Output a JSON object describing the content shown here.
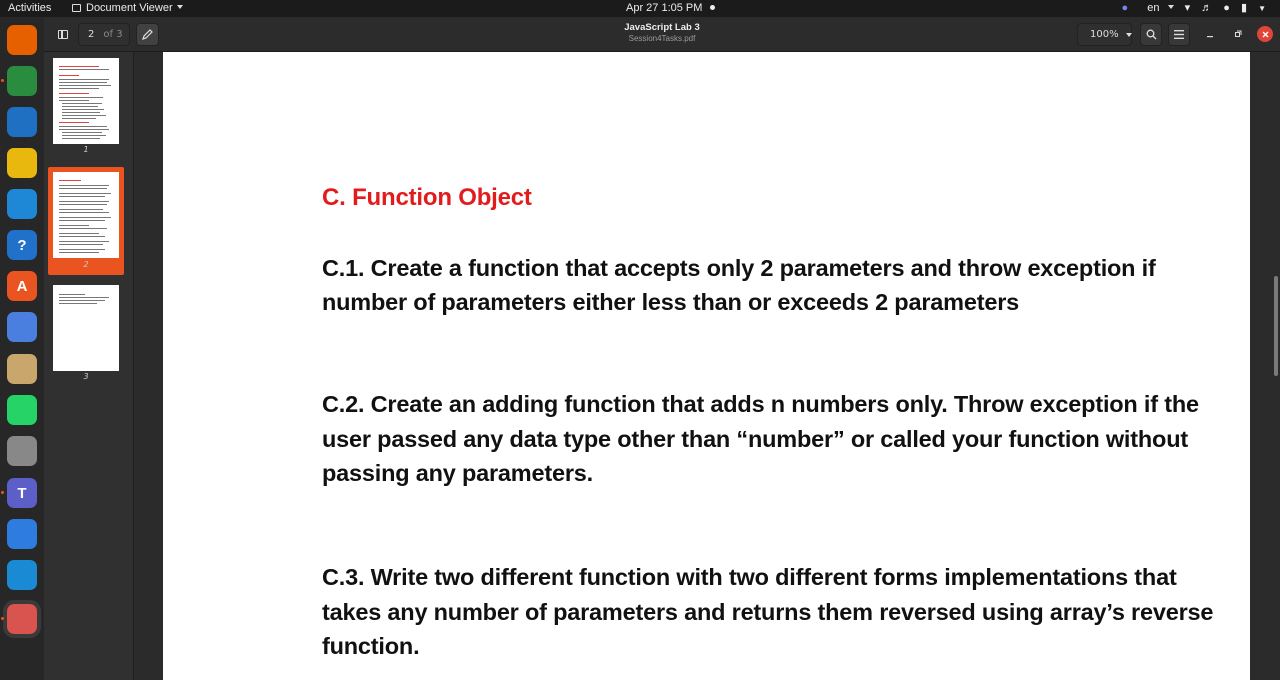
{
  "topbar": {
    "activities": "Activities",
    "app_name": "Document Viewer",
    "clock": "Apr 27  1:05 PM",
    "language": "en"
  },
  "dock": {
    "apps": [
      {
        "name": "firefox-icon",
        "color": "#e66000",
        "glyph": "",
        "running": false
      },
      {
        "name": "chrome-icon",
        "color": "#2a8c3e",
        "glyph": "",
        "running": true
      },
      {
        "name": "thunderbird-icon",
        "color": "#1f6fc2",
        "glyph": "",
        "running": false
      },
      {
        "name": "rhythmbox-icon",
        "color": "#e8b80f",
        "glyph": "",
        "running": false
      },
      {
        "name": "writer-icon",
        "color": "#1e88d6",
        "glyph": "",
        "running": false
      },
      {
        "name": "help-icon",
        "color": "#2170c9",
        "glyph": "?",
        "running": false
      },
      {
        "name": "app-center-icon",
        "color": "#e95420",
        "glyph": "A",
        "running": false
      },
      {
        "name": "chromium-icon",
        "color": "#4a7fe0",
        "glyph": "",
        "running": false
      },
      {
        "name": "files-icon",
        "color": "#c9a66b",
        "glyph": "",
        "running": false
      },
      {
        "name": "whatsapp-icon",
        "color": "#25d366",
        "glyph": "",
        "running": false
      },
      {
        "name": "settings-icon",
        "color": "#888888",
        "glyph": "",
        "running": false
      },
      {
        "name": "teams-icon",
        "color": "#5b5fc7",
        "glyph": "T",
        "running": true
      },
      {
        "name": "text-editor-icon",
        "color": "#2f7ce0",
        "glyph": "",
        "running": false
      },
      {
        "name": "vscode-icon",
        "color": "#1a8ad4",
        "glyph": "",
        "running": false
      },
      {
        "name": "document-viewer-icon",
        "color": "#d9534f",
        "glyph": "",
        "running": true
      }
    ]
  },
  "header": {
    "page_number": "2",
    "page_of": "of 3",
    "title": "JavaScript Lab 3",
    "subtitle": "Session4Tasks.pdf",
    "zoom": "100%"
  },
  "sidebar": {
    "thumbnails": [
      {
        "label": "1",
        "selected": false
      },
      {
        "label": "2",
        "selected": true
      },
      {
        "label": "3",
        "selected": false
      }
    ]
  },
  "document": {
    "section_title": "C. Function Object",
    "tasks": [
      "C.1. Create a function that accepts only 2 parameters and throw exception if number of parameters either less than or exceeds 2 parameters",
      "C.2. Create an adding function that adds n numbers only. Throw exception if the user passed any data type other than “number” or called your function without passing any parameters.",
      "C.3. Write two different function with two different forms implementations that takes any number of parameters and returns them reversed using array’s reverse function."
    ]
  }
}
